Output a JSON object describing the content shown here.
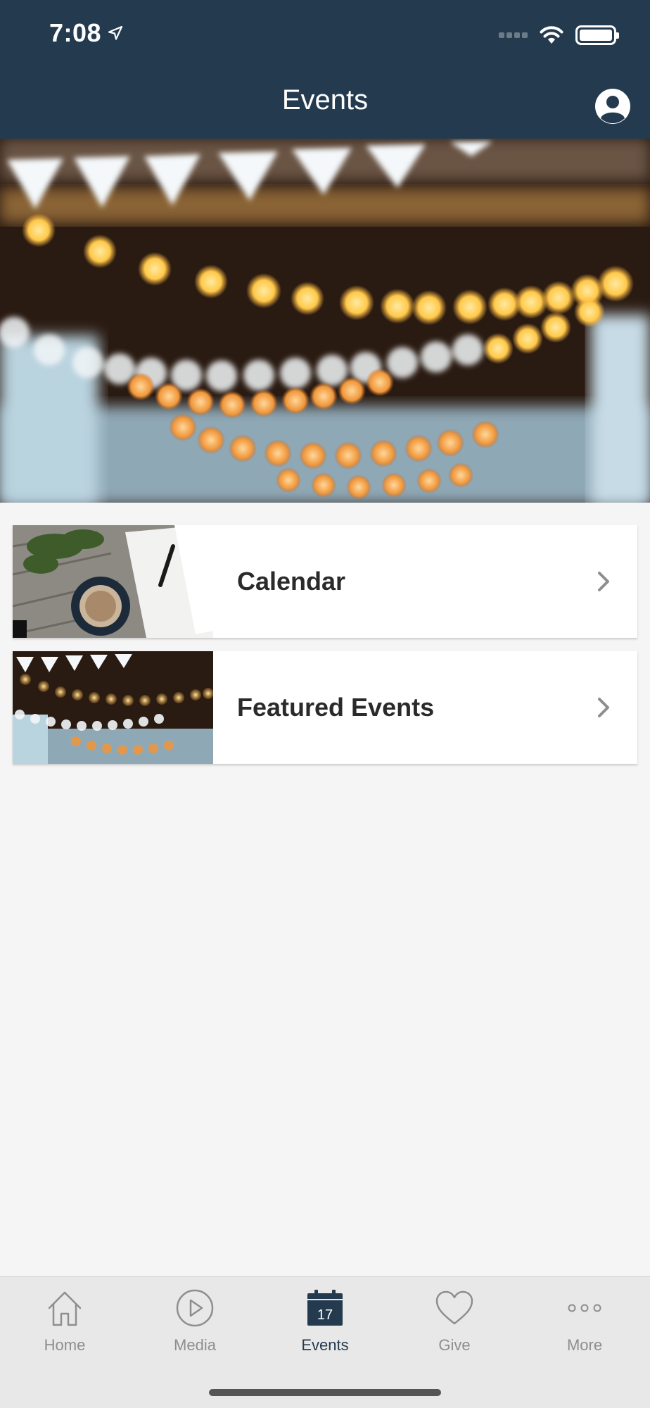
{
  "status_bar": {
    "time": "7:08"
  },
  "header": {
    "title": "Events"
  },
  "cards": [
    {
      "label": "Calendar"
    },
    {
      "label": "Featured Events"
    }
  ],
  "tabbar": {
    "tabs": [
      {
        "label": "Home",
        "icon": "home-icon"
      },
      {
        "label": "Media",
        "icon": "play-icon"
      },
      {
        "label": "Events",
        "icon": "calendar-icon",
        "active": true,
        "day": "17"
      },
      {
        "label": "Give",
        "icon": "heart-icon"
      },
      {
        "label": "More",
        "icon": "more-icon"
      }
    ]
  },
  "colors": {
    "header_bg": "#243b4f",
    "active_tab": "#243b4f",
    "inactive_tab": "#8e8e8e",
    "background": "#f5f5f5"
  }
}
